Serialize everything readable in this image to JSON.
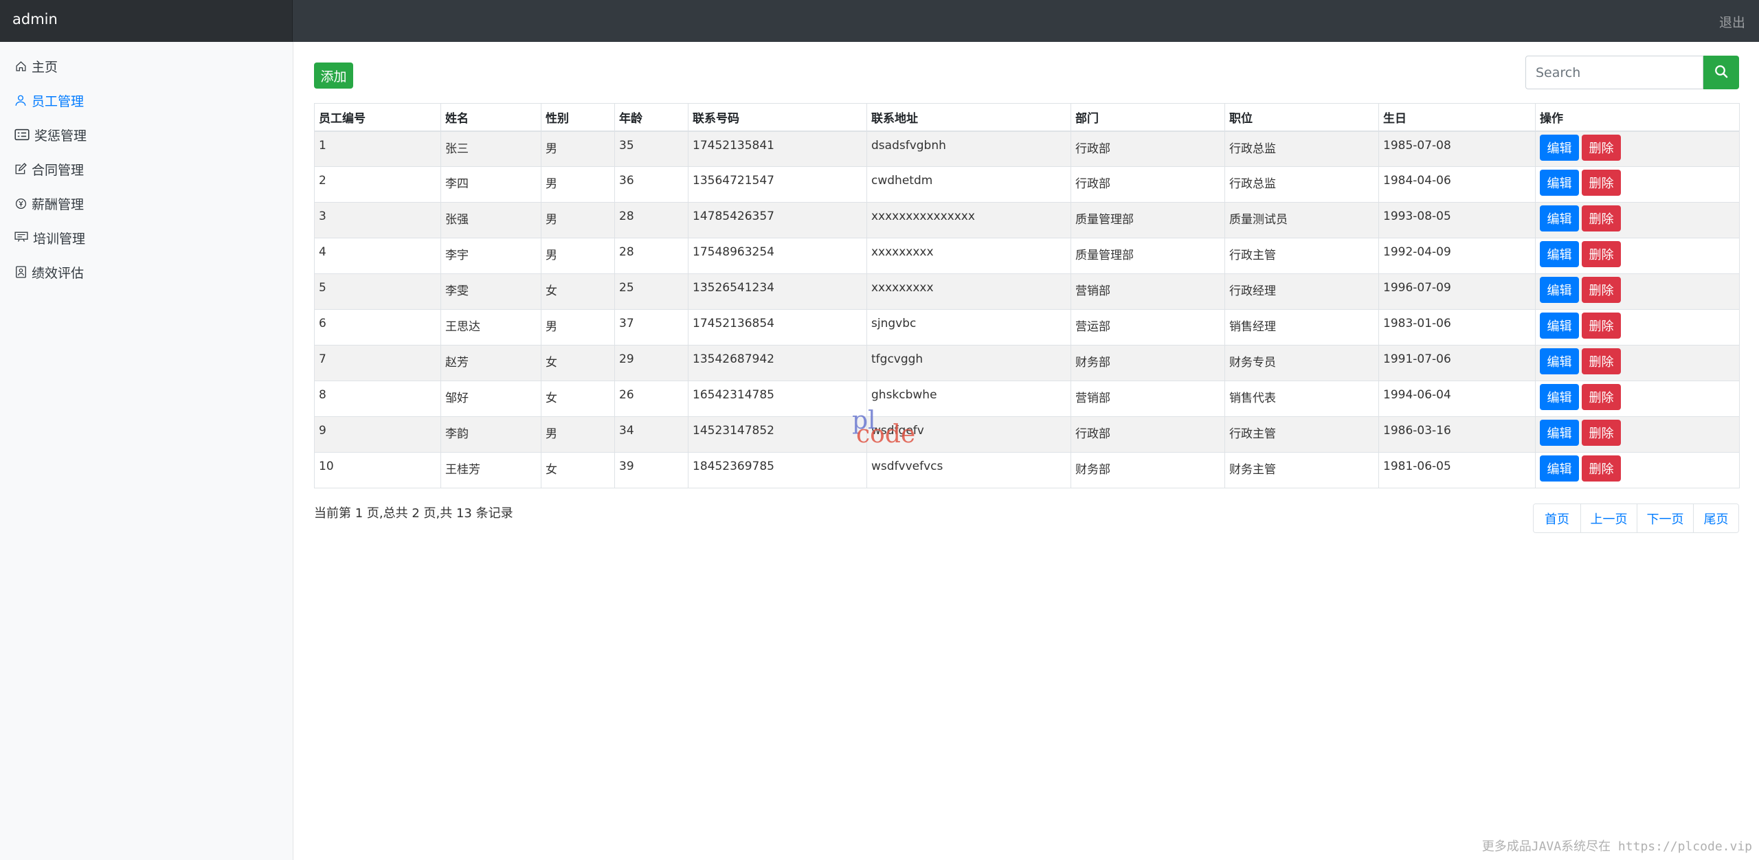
{
  "navbar": {
    "brand": "admin",
    "logout": "退出"
  },
  "sidebar": {
    "items": [
      {
        "label": "主页",
        "icon": "house-icon",
        "active": false
      },
      {
        "label": "员工管理",
        "icon": "person-icon",
        "active": true
      },
      {
        "label": "奖惩管理",
        "icon": "card-list-icon",
        "active": false
      },
      {
        "label": "合同管理",
        "icon": "pencil-square-icon",
        "active": false
      },
      {
        "label": "薪酬管理",
        "icon": "yen-circle-icon",
        "active": false
      },
      {
        "label": "培训管理",
        "icon": "presentation-icon",
        "active": false
      },
      {
        "label": "绩效评估",
        "icon": "file-person-icon",
        "active": false
      }
    ]
  },
  "toolbar": {
    "add_label": "添加",
    "search_placeholder": "Search",
    "search_icon": "search-icon"
  },
  "table": {
    "headers": [
      "员工编号",
      "姓名",
      "性别",
      "年龄",
      "联系号码",
      "联系地址",
      "部门",
      "职位",
      "生日",
      "操作"
    ],
    "rows": [
      [
        "1",
        "张三",
        "男",
        "35",
        "17452135841",
        "dsadsfvgbnh",
        "行政部",
        "行政总监",
        "1985-07-08"
      ],
      [
        "2",
        "李四",
        "男",
        "36",
        "13564721547",
        "cwdhetdm",
        "行政部",
        "行政总监",
        "1984-04-06"
      ],
      [
        "3",
        "张强",
        "男",
        "28",
        "14785426357",
        "xxxxxxxxxxxxxxx",
        "质量管理部",
        "质量测试员",
        "1993-08-05"
      ],
      [
        "4",
        "李宇",
        "男",
        "28",
        "17548963254",
        "xxxxxxxxx",
        "质量管理部",
        "行政主管",
        "1992-04-09"
      ],
      [
        "5",
        "李雯",
        "女",
        "25",
        "13526541234",
        "xxxxxxxxx",
        "营销部",
        "行政经理",
        "1996-07-09"
      ],
      [
        "6",
        "王思达",
        "男",
        "37",
        "17452136854",
        "sjngvbc",
        "营运部",
        "销售经理",
        "1983-01-06"
      ],
      [
        "7",
        "赵芳",
        "女",
        "29",
        "13542687942",
        "tfgcvggh",
        "财务部",
        "财务专员",
        "1991-07-06"
      ],
      [
        "8",
        "邹好",
        "女",
        "26",
        "16542314785",
        "ghskcbwhe",
        "营销部",
        "销售代表",
        "1994-06-04"
      ],
      [
        "9",
        "李韵",
        "男",
        "34",
        "14523147852",
        "wsdfgefv",
        "行政部",
        "行政主管",
        "1986-03-16"
      ],
      [
        "10",
        "王桂芳",
        "女",
        "39",
        "18452369785",
        "wsdfvvefvcs",
        "财务部",
        "财务主管",
        "1981-06-05"
      ]
    ],
    "edit_label": "编辑",
    "delete_label": "删除"
  },
  "pagination": {
    "info": "当前第 1 页,总共 2 页,共 13 条记录",
    "first": "首页",
    "prev": "上一页",
    "next": "下一页",
    "last": "尾页"
  },
  "watermark": {
    "line1": "pl",
    "line2": "code"
  },
  "footer_note": "更多成品JAVA系统尽在 https://plcode.vip",
  "colors": {
    "navbar": "#343a40",
    "primary": "#007bff",
    "success": "#28a745",
    "danger": "#dc3545",
    "sidebar_bg": "#f8f9fa"
  }
}
